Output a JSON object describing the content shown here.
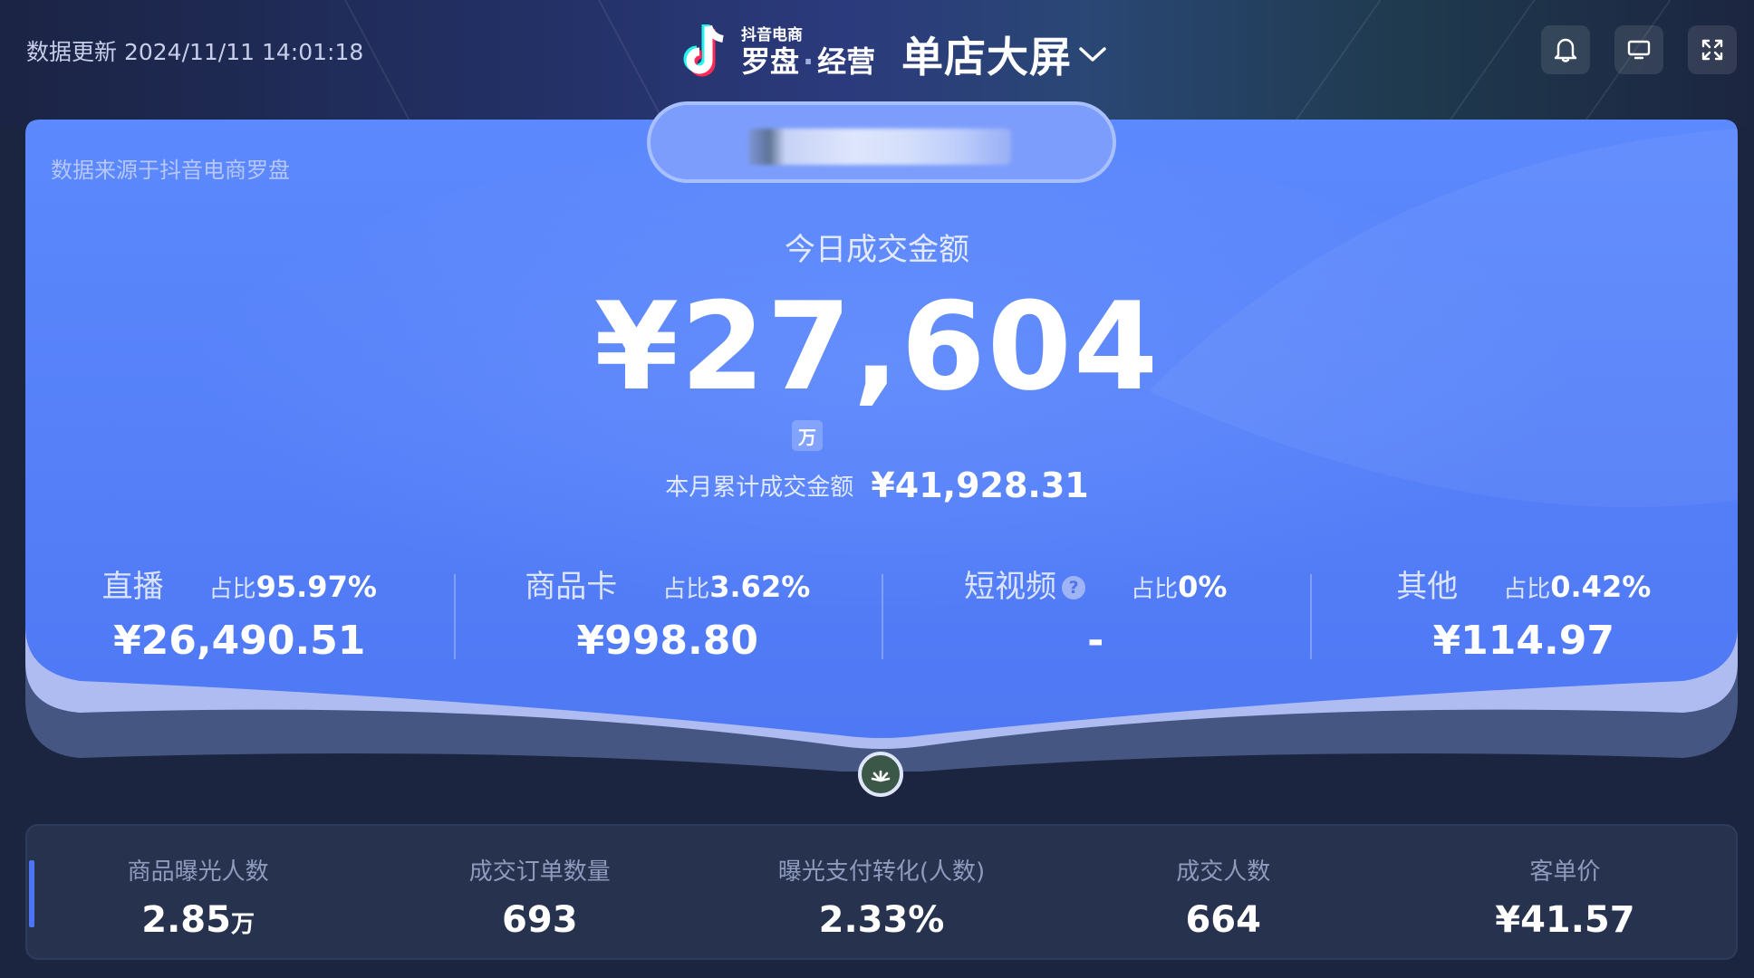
{
  "header": {
    "update_time": "数据更新 2024/11/11 14:01:18",
    "brand_small": "抖音电商",
    "brand_main_a": "罗盘",
    "brand_dot": "·",
    "brand_main_b": "经营",
    "screen_title": "单店大屏",
    "icons": [
      "bell-icon",
      "monitor-icon",
      "fullscreen-icon"
    ]
  },
  "main": {
    "source_note": "数据来源于抖音电商罗盘",
    "today_label": "今日成交金额",
    "today_amount": "¥27,604",
    "wan_badge": "万",
    "month_label": "本月累计成交金额",
    "month_value": "¥41,928.31",
    "channels": [
      {
        "name": "直播",
        "pct_label": "占比",
        "pct": "95.97%",
        "value": "¥26,490.51"
      },
      {
        "name": "商品卡",
        "pct_label": "占比",
        "pct": "3.62%",
        "value": "¥998.80"
      },
      {
        "name": "短视频",
        "help": "?",
        "pct_label": "占比",
        "pct": "0%",
        "value": "-"
      },
      {
        "name": "其他",
        "pct_label": "占比",
        "pct": "0.42%",
        "value": "¥114.97"
      }
    ]
  },
  "metrics": [
    {
      "label": "商品曝光人数",
      "value": "2.85",
      "unit": "万"
    },
    {
      "label": "成交订单数量",
      "value": "693"
    },
    {
      "label": "曝光支付转化(人数)",
      "value": "2.33%"
    },
    {
      "label": "成交人数",
      "value": "664"
    },
    {
      "label": "客单价",
      "value": "¥41.57"
    }
  ],
  "colors": {
    "background": "#1c2540",
    "card_blue": "#5a86fb",
    "accent": "#4c74f5"
  }
}
